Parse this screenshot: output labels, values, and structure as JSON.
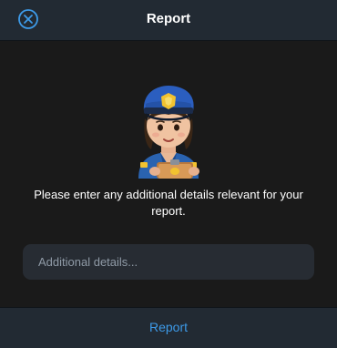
{
  "header": {
    "title": "Report",
    "close_icon": "close-circle-icon"
  },
  "mascot": {
    "icon": "police-officer-icon"
  },
  "prompt": {
    "text": "Please enter any additional details relevant for your report."
  },
  "details": {
    "placeholder": "Additional details...",
    "value": ""
  },
  "footer": {
    "report_label": "Report"
  },
  "colors": {
    "background": "#1a1a1a",
    "bar": "#222a33",
    "accent": "#3d9ae8",
    "input": "#272c33"
  }
}
